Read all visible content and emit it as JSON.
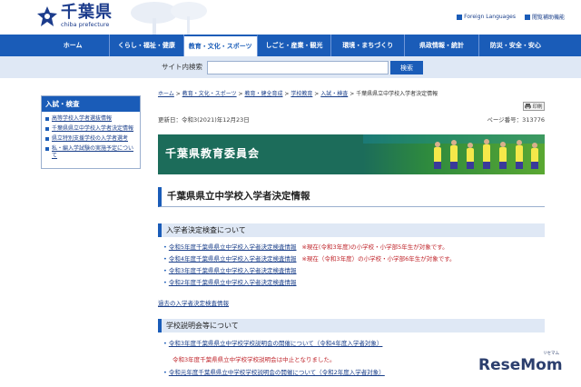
{
  "header": {
    "logo_jp": "千葉県",
    "logo_en": "chiba prefecture",
    "links": [
      "Foreign Languages",
      "閲覧補助機能"
    ]
  },
  "nav": {
    "items": [
      {
        "label": "ホーム"
      },
      {
        "label": "くらし・福祉・健康"
      },
      {
        "label": "教育・文化・スポーツ"
      },
      {
        "label": "しごと・産業・観光"
      },
      {
        "label": "環境・まちづくり"
      },
      {
        "label": "県政情報・統計"
      },
      {
        "label": "防災・安全・安心"
      }
    ]
  },
  "search": {
    "label": "サイト内検索",
    "placeholder": "",
    "button": "検索"
  },
  "sidebar": {
    "heading": "入試・検査",
    "items": [
      {
        "label": "高等学校入学者選抜情報"
      },
      {
        "label": "千葉県県立中学校入学者決定情報"
      },
      {
        "label": "県立特別支援学校の入学者選考"
      },
      {
        "label": "私・編入学試験の実施予定について"
      }
    ]
  },
  "breadcrumb": {
    "items": [
      "ホーム",
      "教育・文化・スポーツ",
      "教育・健全育成",
      "学校教育",
      "入試・検査"
    ],
    "sep": ">",
    "current": "千葉県県立中学校入学者決定情報"
  },
  "print_label": "印刷",
  "meta": {
    "updated": "更新日：令和3(2021)年12月23日",
    "page_no": "ページ番号：313776"
  },
  "banner": {
    "title": "千葉県教育委員会"
  },
  "page_title": "千葉県県立中学校入学者決定情報",
  "section1": {
    "heading": "入学者決定検査について",
    "links": [
      {
        "text": "令和5年度千葉県県立中学校入学者決定検査情報",
        "note": "※現在(令和3年度)の小学校・小学部5年生が対象です。"
      },
      {
        "text": "令和4年度千葉県県立中学校入学者決定検査情報",
        "note": "※現在（令和3年度）の小学校・小学部6年生が対象です。"
      },
      {
        "text": "令和3年度千葉県県立中学校入学者決定検査情報",
        "note": ""
      },
      {
        "text": "令和2年度千葉県県立中学校入学者決定検査情報",
        "note": ""
      }
    ],
    "past_link": "過去の入学者決定検査情報"
  },
  "section2": {
    "heading": "学校説明会等について",
    "links": [
      {
        "text": "令和3年度千葉県県立中学校学校説明会の開催について（令和4年度入学者対象）"
      },
      {
        "text": "令和元年度千葉県県立中学校学校説明会の開催について（令和2年度入学者対象）"
      }
    ],
    "cancel_note": "令和3年度千葉県県立中学校学校説明会は中止となりました。"
  },
  "watermark": {
    "text": "ReseMom",
    "sub": "リセマム"
  },
  "colors": {
    "primary": "#1a5cb8",
    "band": "#dfe8f5",
    "note_red": "#c0272d",
    "banner_green": "#1c6c5a"
  },
  "icons": {
    "logo": "chiba-logo-icon",
    "print": "printer-icon"
  }
}
